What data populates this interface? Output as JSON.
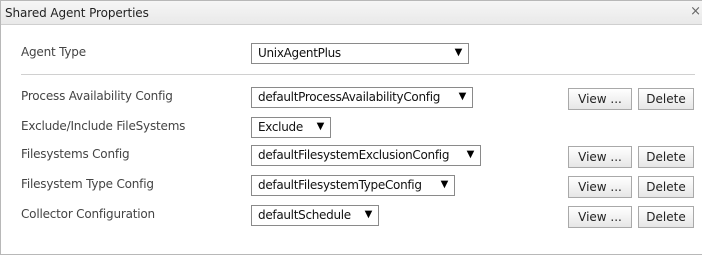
{
  "dialog": {
    "title": "Shared Agent Properties",
    "close_glyph": "×"
  },
  "agent_type": {
    "label": "Agent Type",
    "value": "UnixAgentPlus"
  },
  "rows": [
    {
      "label": "Process Availability Config",
      "value": "defaultProcessAvailabilityConfig",
      "view_label": "View ...",
      "delete_label": "Delete"
    },
    {
      "label": "Exclude/Include FileSystems",
      "value": "Exclude"
    },
    {
      "label": "Filesystems Config",
      "value": "defaultFilesystemExclusionConfig",
      "view_label": "View ...",
      "delete_label": "Delete"
    },
    {
      "label": "Filesystem Type Config",
      "value": "defaultFilesystemTypeConfig",
      "view_label": "View ...",
      "delete_label": "Delete"
    },
    {
      "label": "Collector Configuration",
      "value": "defaultSchedule",
      "view_label": "View ...",
      "delete_label": "Delete"
    }
  ],
  "icons": {
    "dropdown": "chevron-down-icon",
    "close": "close-icon"
  },
  "colors": {
    "titlebar": "#ececec",
    "border": "#8a8a8a"
  }
}
